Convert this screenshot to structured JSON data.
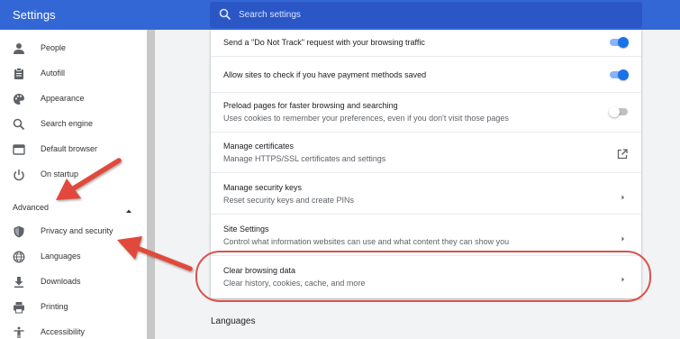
{
  "header": {
    "app_title": "Settings",
    "search_placeholder": "Search settings",
    "accent_color": "#3367d6"
  },
  "sidebar": {
    "items": [
      {
        "label": "People",
        "icon": "person-icon"
      },
      {
        "label": "Autofill",
        "icon": "clipboard-icon"
      },
      {
        "label": "Appearance",
        "icon": "palette-icon"
      },
      {
        "label": "Search engine",
        "icon": "search-icon"
      },
      {
        "label": "Default browser",
        "icon": "browser-icon"
      },
      {
        "label": "On startup",
        "icon": "power-icon"
      }
    ],
    "advanced_label": "Advanced",
    "advanced_items": [
      {
        "label": "Privacy and security",
        "icon": "shield-icon"
      },
      {
        "label": "Languages",
        "icon": "globe-icon"
      },
      {
        "label": "Downloads",
        "icon": "download-icon"
      },
      {
        "label": "Printing",
        "icon": "printer-icon"
      },
      {
        "label": "Accessibility",
        "icon": "accessibility-icon"
      }
    ]
  },
  "settings_rows": [
    {
      "title": "Send a \"Do Not Track\" request with your browsing traffic",
      "control": "toggle",
      "enabled": true
    },
    {
      "title": "Allow sites to check if you have payment methods saved",
      "control": "toggle",
      "enabled": true
    },
    {
      "title": "Preload pages for faster browsing and searching",
      "subtitle": "Uses cookies to remember your preferences, even if you don't visit those pages",
      "control": "toggle",
      "enabled": false
    },
    {
      "title": "Manage certificates",
      "subtitle": "Manage HTTPS/SSL certificates and settings",
      "control": "external-link-icon"
    },
    {
      "title": "Manage security keys",
      "subtitle": "Reset security keys and create PINs",
      "control": "chevron-right-icon"
    },
    {
      "title": "Site Settings",
      "subtitle": "Control what information websites can use and what content they can show you",
      "control": "chevron-right-icon"
    },
    {
      "title": "Clear browsing data",
      "subtitle": "Clear history, cookies, cache, and more",
      "control": "chevron-right-icon"
    }
  ],
  "next_section": "Languages",
  "annotations": {
    "arrow_color": "#e04a3a",
    "highlight_color": "#d9534f"
  }
}
